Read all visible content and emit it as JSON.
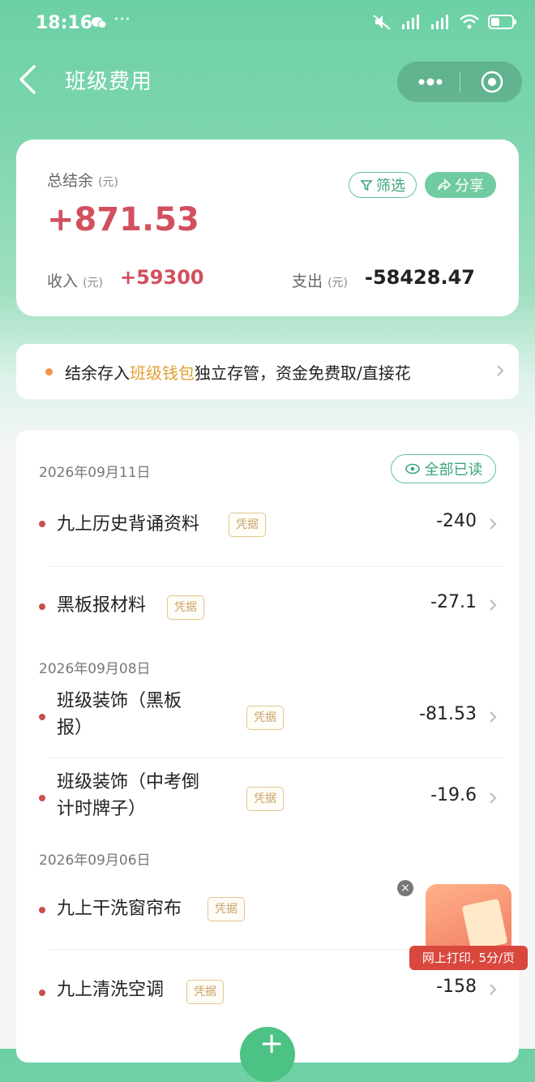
{
  "status_bar": {
    "time": "18:16",
    "more": "···",
    "network_1": "5G",
    "network_2": "5G"
  },
  "nav": {
    "title": "班级费用"
  },
  "summary": {
    "balance_label": "总结余",
    "unit": "(元)",
    "balance_value": "+871.53",
    "filter_label": "筛选",
    "share_label": "分享",
    "income_label": "收入",
    "income_value": "+59300",
    "expense_label": "支出",
    "expense_value": "-58428.47"
  },
  "banner": {
    "text_before": "结余存入",
    "highlight": "班级钱包",
    "text_after": "独立存管，资金免费取/直接花"
  },
  "list": {
    "read_all_label": "全部已读",
    "voucher_label": "凭据",
    "groups": [
      {
        "date": "2026年09月11日",
        "items": [
          {
            "name": "九上历史背诵资料",
            "amount": "-240"
          },
          {
            "name": "黑板报材料",
            "amount": "-27.1"
          }
        ]
      },
      {
        "date": "2026年09月08日",
        "items": [
          {
            "name_line1": "班级装饰（黑板",
            "name_line2": "报）",
            "amount": "-81.53"
          },
          {
            "name_line1": "班级装饰（中考倒",
            "name_line2": "计时牌子）",
            "amount": "-19.6"
          }
        ]
      },
      {
        "date": "2026年09月06日",
        "items": [
          {
            "name": "九上干洗窗帘布",
            "amount": ""
          },
          {
            "name": "九上清洗空调",
            "amount": "-158"
          }
        ]
      }
    ]
  },
  "ad": {
    "label": "网上打印, 5分/页",
    "close": "×"
  },
  "colors": {
    "brand_green": "#6cd0a5",
    "income_red": "#d2505e",
    "tag_gold": "#c9a36a"
  }
}
